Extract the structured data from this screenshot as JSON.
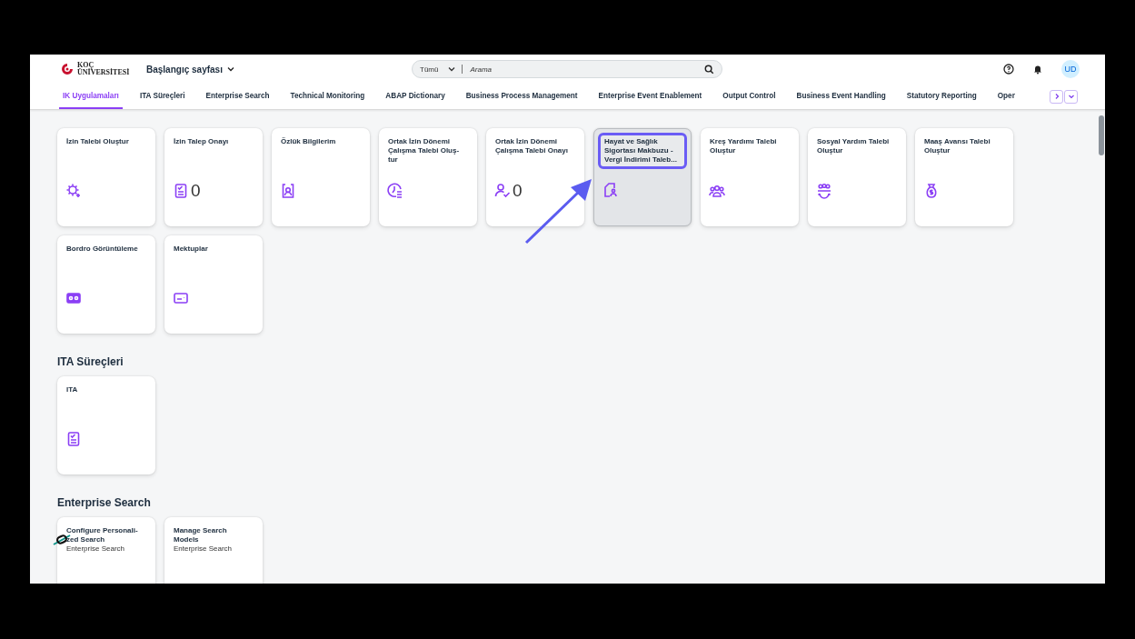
{
  "header": {
    "logo_text": "KOÇ ÜNİVERSİTESİ",
    "page_title": "Başlangıç sayfası",
    "search": {
      "scope": "Tümü",
      "placeholder": "Arama"
    },
    "avatar": "UD"
  },
  "tabs": [
    {
      "label": "IK Uygulamaları",
      "selected": true
    },
    {
      "label": "ITA Süreçleri",
      "selected": false
    },
    {
      "label": "Enterprise Search",
      "selected": false
    },
    {
      "label": "Technical Monitoring",
      "selected": false
    },
    {
      "label": "ABAP Dictionary",
      "selected": false
    },
    {
      "label": "Business Process Management",
      "selected": false
    },
    {
      "label": "Enterprise Event Enablement",
      "selected": false
    },
    {
      "label": "Output Control",
      "selected": false
    },
    {
      "label": "Business Event Handling",
      "selected": false
    },
    {
      "label": "Statutory Reporting",
      "selected": false
    },
    {
      "label": "Oper",
      "selected": false
    }
  ],
  "sections": [
    {
      "tiles": [
        {
          "title": "İzin Talebi Oluştur",
          "highlighted": false
        },
        {
          "title": "İzin Talep Onayı",
          "count": "0",
          "highlighted": false
        },
        {
          "title": "Özlük Bilgilerim",
          "highlighted": false
        },
        {
          "title": "Ortak İzin Dönemi Çalışma Talebi Oluş-tur",
          "highlighted": false
        },
        {
          "title": "Ortak İzin Dönemi Çalışma Talebi Onayı",
          "count": "0",
          "highlighted": false
        },
        {
          "title": "Hayat ve Sağlık Sigortası Makbuzu - Vergi İndirimi Taleb...",
          "highlighted": true
        },
        {
          "title": "Kreş Yardımı Talebi Oluştur",
          "highlighted": false
        },
        {
          "title": "Sosyal Yardım Talebi Oluştur",
          "highlighted": false
        },
        {
          "title": "Maaş Avansı Talebi Oluştur",
          "highlighted": false
        },
        {
          "title": "Bordro Görüntüleme",
          "highlighted": false
        },
        {
          "title": "Mektuplar",
          "highlighted": false
        }
      ]
    },
    {
      "heading": "ITA Süreçleri",
      "tiles": [
        {
          "title": "ITA",
          "highlighted": false
        }
      ]
    },
    {
      "heading": "Enterprise Search",
      "tiles": [
        {
          "title": "Configure Personali-zed Search",
          "subtitle": "Enterprise Search",
          "highlighted": false
        },
        {
          "title": "Manage Search Models",
          "subtitle": "Enterprise Search",
          "highlighted": false
        }
      ]
    }
  ]
}
